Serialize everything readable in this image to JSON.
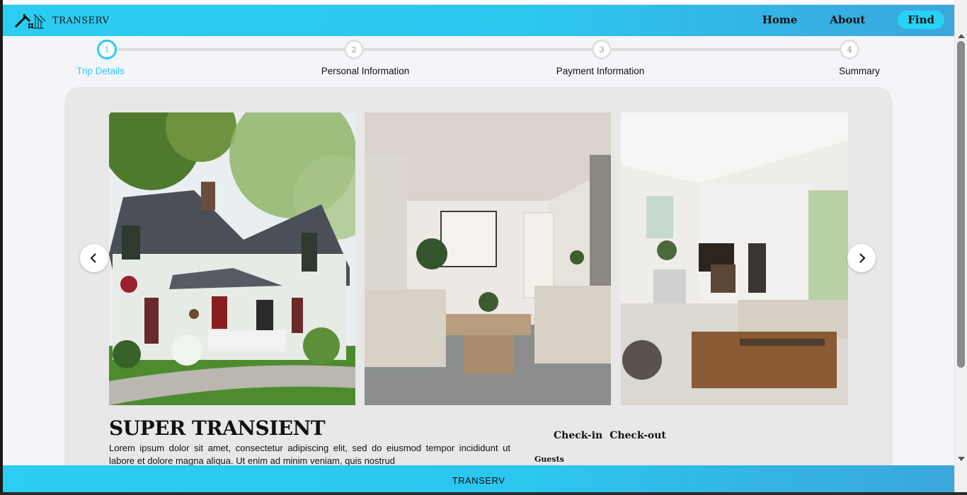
{
  "brand": {
    "name": "TRANSERV"
  },
  "nav": {
    "home": "Home",
    "about": "About",
    "find": "Find"
  },
  "stepper": {
    "steps": [
      {
        "number": "1",
        "label": "Trip Details"
      },
      {
        "number": "2",
        "label": "Personal Information"
      },
      {
        "number": "3",
        "label": "Payment Information"
      },
      {
        "number": "4",
        "label": "Summary"
      }
    ],
    "active_index": 0
  },
  "listing": {
    "title": "SUPER TRANSIENT",
    "description": "Lorem ipsum dolor sit amet, consectetur adipiscing elit, sed do eiusmod tempor incididunt ut labore et dolore magna aliqua. Ut enim ad minim veniam, quis nostrud",
    "checkin_label": "Check-in",
    "checkout_label": "Check-out",
    "guests_label": "Guests"
  },
  "footer": {
    "text": "TRANSERV"
  },
  "colors": {
    "accent": "#2bcdf2",
    "gradient_end": "#3aa6dc",
    "card_bg": "#e8e8e8",
    "page_bg": "#f3f5f8"
  },
  "icons": {
    "logo": "house-key-icon",
    "prev": "chevron-left-icon",
    "next": "chevron-right-icon"
  }
}
